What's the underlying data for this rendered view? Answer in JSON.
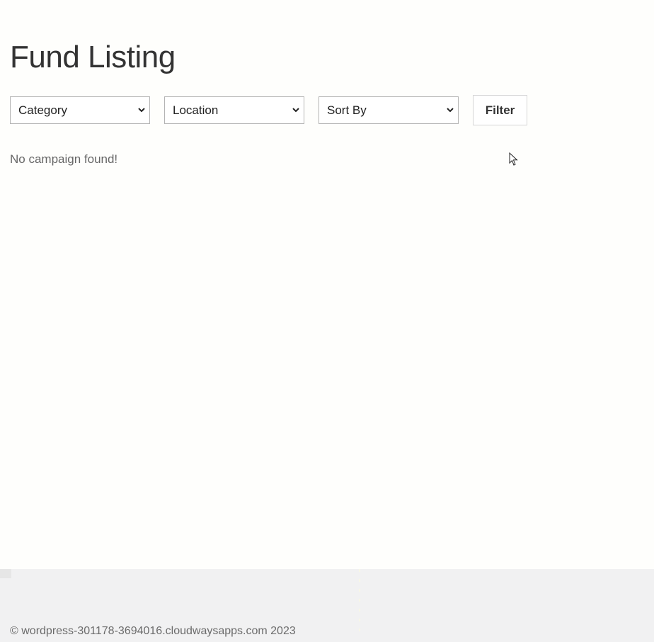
{
  "page": {
    "title": "Fund Listing"
  },
  "filters": {
    "category": {
      "selected": "Category"
    },
    "location": {
      "selected": "Location"
    },
    "sort_by": {
      "selected": "Sort By"
    },
    "filter_button_label": "Filter"
  },
  "results": {
    "empty_message": "No campaign found!"
  },
  "footer": {
    "copyright": "© wordpress-301178-3694016.cloudwaysapps.com 2023"
  },
  "icons": {
    "select_arrow": "chevron-down-icon",
    "cursor": "mouse-pointer-icon"
  },
  "colors": {
    "background": "#fefefc",
    "footer_background": "#f1f1f2",
    "title_text": "#333333",
    "muted_text": "#666666"
  }
}
